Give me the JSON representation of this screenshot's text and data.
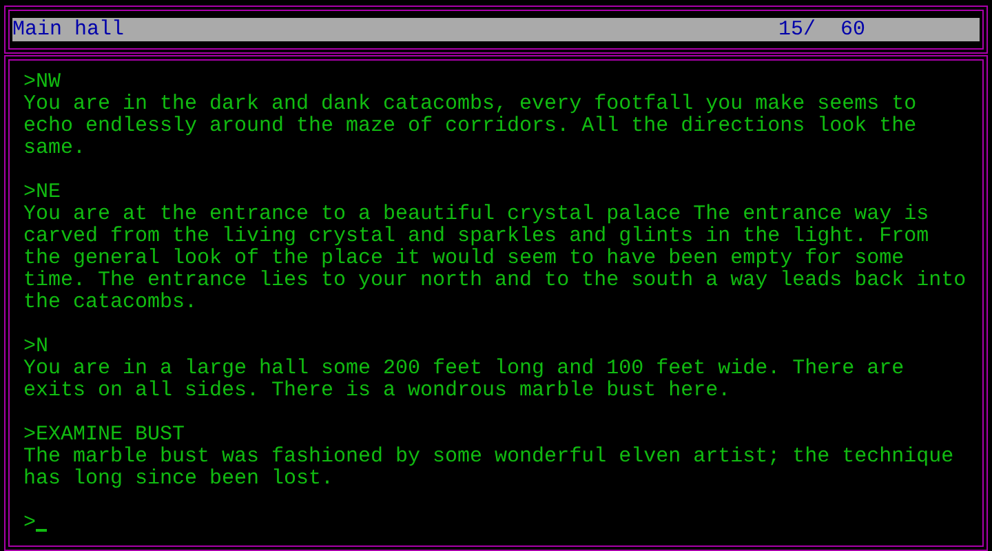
{
  "status_bar": {
    "location": "Main hall",
    "score": "15/  60"
  },
  "transcript": [
    {
      "command": ">NW",
      "response": "You are in the dark and dank catacombs, every footfall you make seems to\necho endlessly around the maze of corridors. All the directions look the\nsame."
    },
    {
      "command": ">NE",
      "response": "You are at the entrance to a beautiful crystal palace The entrance way is\ncarved from the living crystal and sparkles and glints in the light. From\nthe general look of the place it would seem to have been empty for some\ntime. The entrance lies to your north and to the south a way leads back into\nthe catacombs."
    },
    {
      "command": ">N",
      "response": "You are in a large hall some 200 feet long and 100 feet wide. There are\nexits on all sides. There is a wondrous marble bust here."
    },
    {
      "command": ">EXAMINE BUST",
      "response": "The marble bust was fashioned by some wonderful elven artist; the technique\nhas long since been lost."
    }
  ],
  "prompt": ">"
}
